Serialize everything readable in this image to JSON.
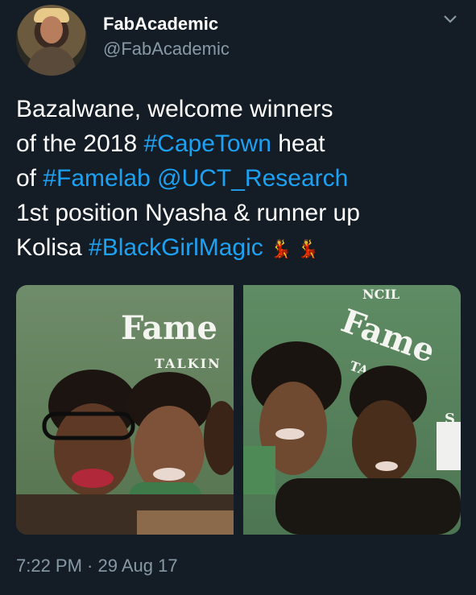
{
  "author": {
    "name": "FabAcademic",
    "handle": "@FabAcademic"
  },
  "tweet": {
    "line1": "Bazalwane, welcome winners",
    "line2_a": "of the 2018 ",
    "line2_link": "#CapeTown",
    "line2_b": " heat",
    "line3_a": "of ",
    "line3_link1": "#Famelab",
    "line3_space": " ",
    "line3_link2": "@UCT_Research",
    "line4": "1st position Nyasha & runner up",
    "line5_a": "Kolisa ",
    "line5_link": "#BlackGirlMagic",
    "emoji": "💃 💃"
  },
  "photos": {
    "left_sign": "Fame",
    "left_sub": "TALKIN",
    "right_sign": "Fame",
    "right_sub": "TA",
    "right_top": "NCIL",
    "right_side": "S"
  },
  "timestamp": "7:22 PM · 29 Aug 17",
  "colors": {
    "background": "#141d26",
    "link": "#1da1f2",
    "secondary": "#8899a6"
  },
  "icons": {
    "more": "chevron-down-icon"
  }
}
